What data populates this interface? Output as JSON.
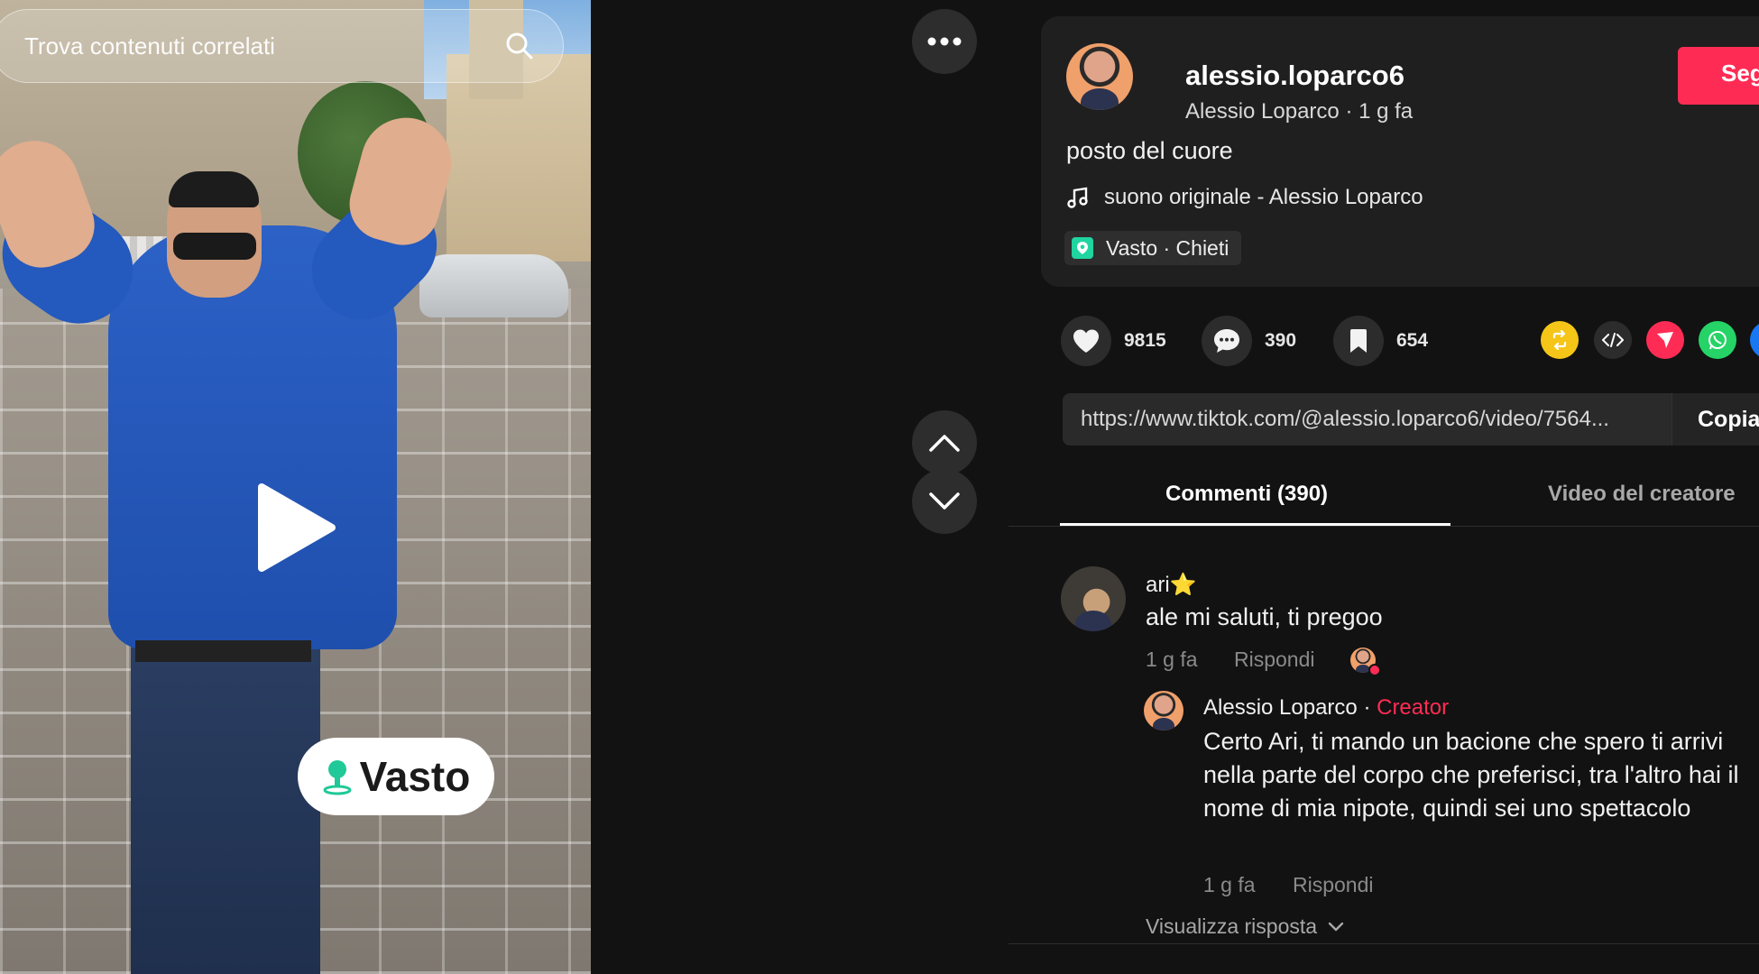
{
  "search": {
    "placeholder": "Trova contenuti correlati",
    "icon": "search-icon"
  },
  "video": {
    "sticker_text": "Vasto",
    "state": "paused"
  },
  "controls": {
    "more_icon": "more-dots-icon",
    "up_icon": "chevron-up-icon",
    "down_icon": "chevron-down-icon"
  },
  "author": {
    "username": "alessio.loparco6",
    "display_name": "Alessio Loparco",
    "separator": "·",
    "time_ago": "1 g fa",
    "follow_label": "Seg"
  },
  "post": {
    "description": "posto del cuore",
    "music": "suono originale - Alessio Loparco",
    "location": "Vasto · Chieti"
  },
  "stats": {
    "likes": "9815",
    "comments": "390",
    "saves": "654"
  },
  "share_colors": {
    "repost": "#f5c518",
    "embed": "#2c2c2c",
    "send": "#fe2c55",
    "whatsapp": "#25d366",
    "more": "#1877f2"
  },
  "link": {
    "url": "https://www.tiktok.com/@alessio.loparco6/video/7564...",
    "copy_label": "Copia"
  },
  "tabs": [
    {
      "label": "Commenti (390)",
      "active": true
    },
    {
      "label": "Video del creatore",
      "active": false
    }
  ],
  "comment": {
    "author": "ari⭐",
    "text": "ale mi saluti, ti pregoo",
    "time": "1 g fa",
    "reply_label": "Rispondi"
  },
  "reply": {
    "author": "Alessio Loparco",
    "separator": "·",
    "tag": "Creator",
    "text": "Certo Ari, ti mando un bacione che spero ti arrivi nella parte del corpo che preferisci, tra l'altro hai il nome di mia nipote, quindi sei uno spettacolo",
    "time": "1 g fa",
    "reply_label": "Rispondi"
  },
  "view_replies": "Visualizza risposta"
}
